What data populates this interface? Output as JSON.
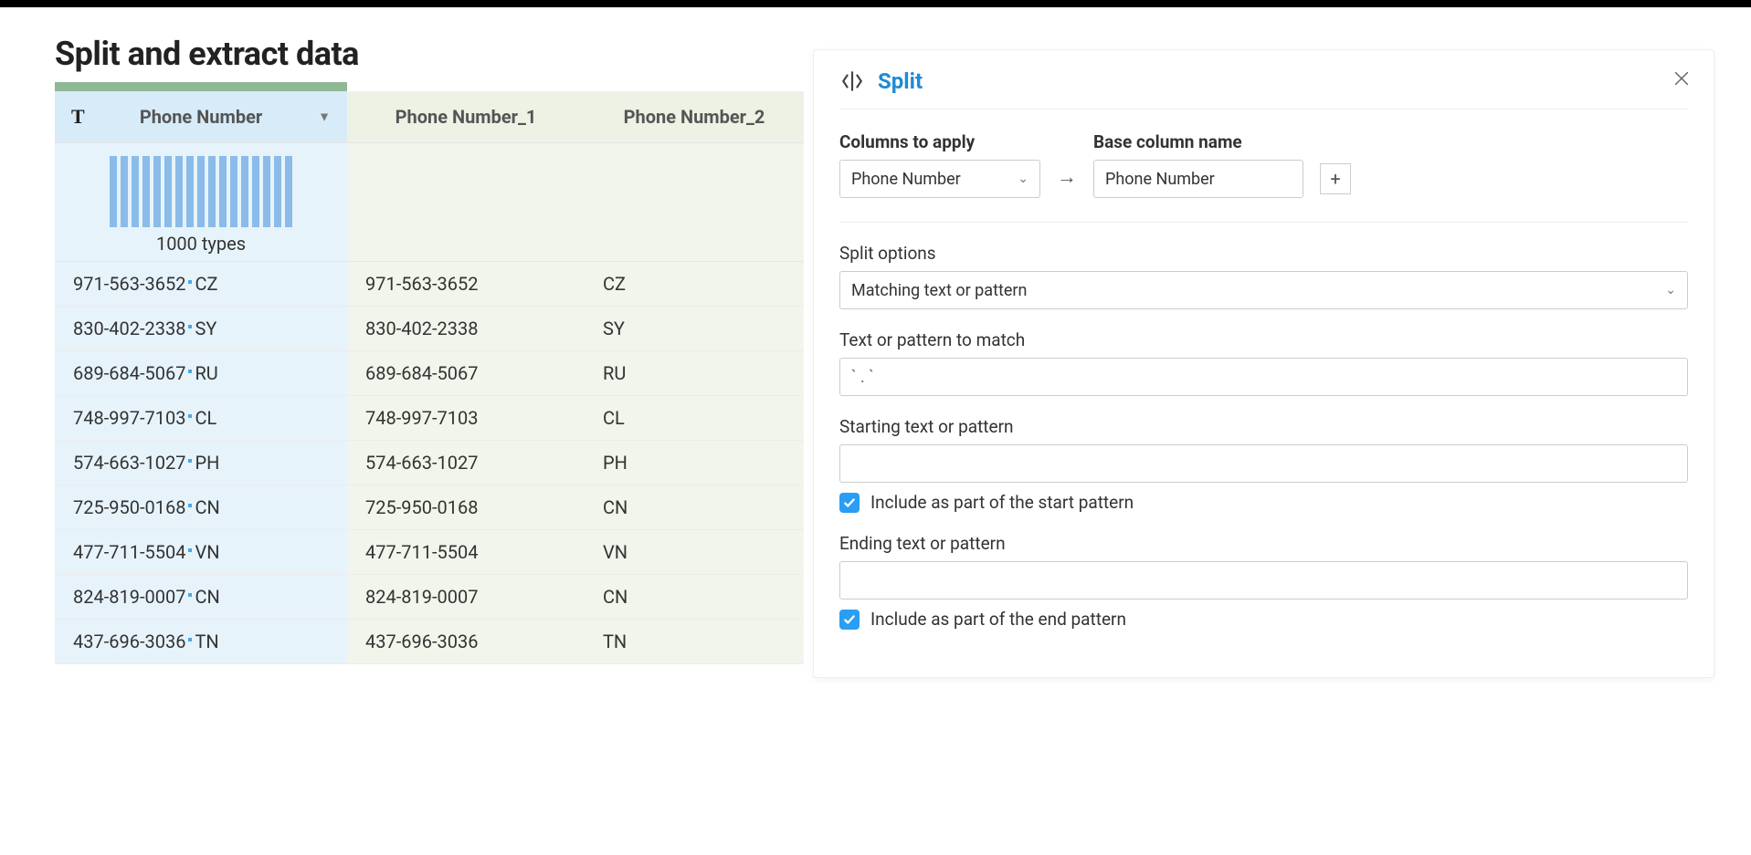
{
  "page": {
    "title": "Split and extract data"
  },
  "table": {
    "columns": {
      "c0": "Phone Number",
      "c1": "Phone Number_1",
      "c2": "Phone Number_2"
    },
    "types_label": "1000 types",
    "rows": [
      {
        "phone": "971-563-3652",
        "cc": "CZ"
      },
      {
        "phone": "830-402-2338",
        "cc": "SY"
      },
      {
        "phone": "689-684-5067",
        "cc": "RU"
      },
      {
        "phone": "748-997-7103",
        "cc": "CL"
      },
      {
        "phone": "574-663-1027",
        "cc": "PH"
      },
      {
        "phone": "725-950-0168",
        "cc": "CN"
      },
      {
        "phone": "477-711-5504",
        "cc": "VN"
      },
      {
        "phone": "824-819-0007",
        "cc": "CN"
      },
      {
        "phone": "437-696-3036",
        "cc": "TN"
      }
    ]
  },
  "panel": {
    "title": "Split",
    "labels": {
      "columns_to_apply": "Columns to apply",
      "base_column_name": "Base column name",
      "split_options": "Split options",
      "text_pattern": "Text or pattern to match",
      "starting_text": "Starting text or pattern",
      "include_start": "Include as part of the start pattern",
      "ending_text": "Ending text or pattern",
      "include_end": "Include as part of the end pattern"
    },
    "values": {
      "column_select": "Phone Number",
      "base_name": "Phone Number",
      "split_options_select": "Matching text or pattern",
      "pattern_value": "` . `",
      "start_value": "",
      "end_value": ""
    }
  }
}
